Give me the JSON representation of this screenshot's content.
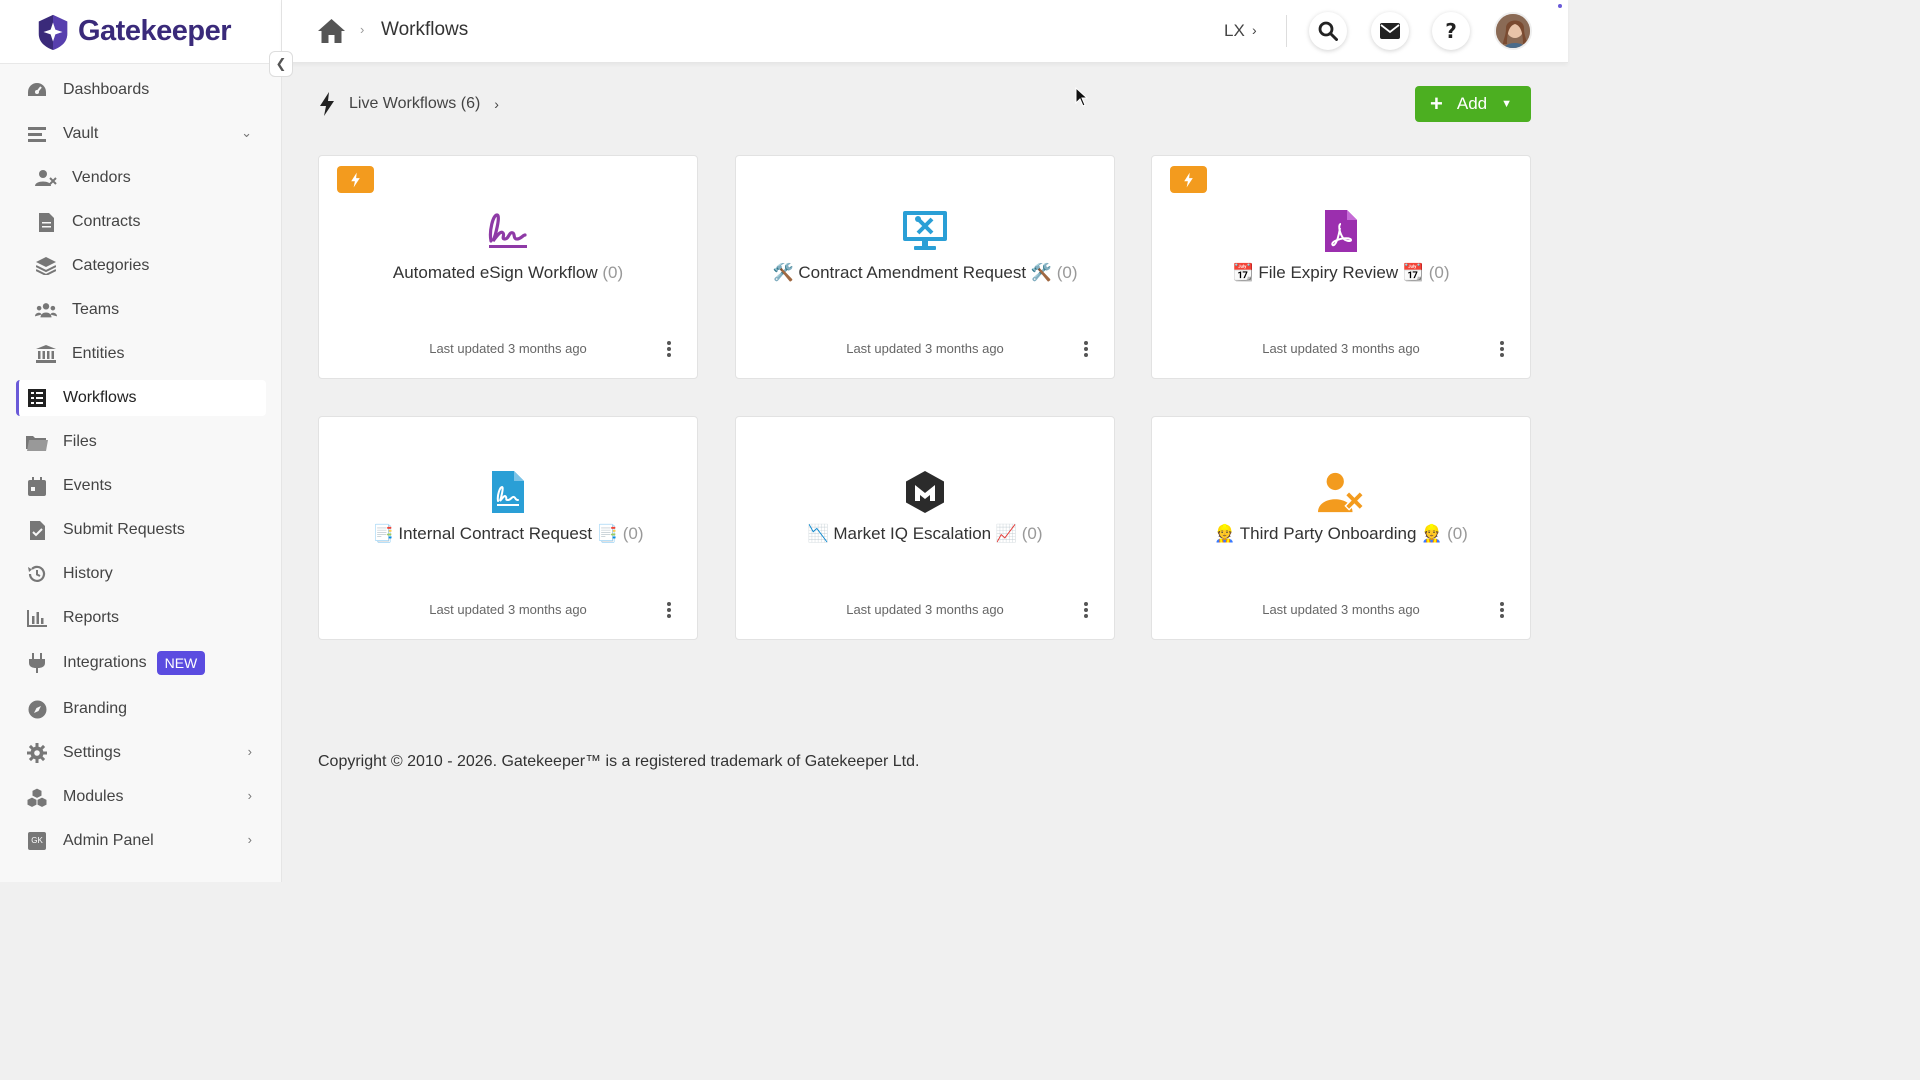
{
  "app": {
    "name": "Gatekeeper",
    "brand_color": "#3a2a7a",
    "accent_color": "#6a5ad8"
  },
  "sidebar": {
    "items": [
      {
        "label": "Dashboards",
        "icon": "dashboard-icon"
      },
      {
        "label": "Vault",
        "icon": "vault-icon",
        "expanded": true
      },
      {
        "label": "Vendors",
        "icon": "vendors-icon"
      },
      {
        "label": "Contracts",
        "icon": "contracts-icon"
      },
      {
        "label": "Categories",
        "icon": "layers-icon"
      },
      {
        "label": "Teams",
        "icon": "teams-icon"
      },
      {
        "label": "Entities",
        "icon": "bank-icon"
      },
      {
        "label": "Workflows",
        "icon": "grid-icon",
        "active": true
      },
      {
        "label": "Files",
        "icon": "folder-icon"
      },
      {
        "label": "Events",
        "icon": "calendar-icon"
      },
      {
        "label": "Submit Requests",
        "icon": "file-check-icon"
      },
      {
        "label": "History",
        "icon": "history-icon"
      },
      {
        "label": "Reports",
        "icon": "bar-chart-icon"
      },
      {
        "label": "Integrations",
        "icon": "plug-icon",
        "badge": "NEW"
      },
      {
        "label": "Branding",
        "icon": "compass-icon"
      },
      {
        "label": "Settings",
        "icon": "gear-icon"
      },
      {
        "label": "Modules",
        "icon": "cubes-icon"
      },
      {
        "label": "Admin Panel",
        "icon": "gk-icon",
        "icon_text": "GK"
      }
    ]
  },
  "header": {
    "breadcrumb_separator": "›",
    "title": "Workflows",
    "org": "LX"
  },
  "main": {
    "live_label": "Live Workflows (6)",
    "add_label": "Add",
    "add_color": "#4caf21",
    "live_tag_color": "#f39b1e",
    "cards": [
      {
        "title": "Automated eSign Workflow",
        "count": "(0)",
        "updated": "Last updated 3 months ago",
        "live": true,
        "icon": "signature-icon",
        "icon_color": "#8e3aa6"
      },
      {
        "title": "🛠️ Contract Amendment Request 🛠️",
        "count": "(0)",
        "updated": "Last updated 3 months ago",
        "live": false,
        "icon": "monitor-tools-icon",
        "icon_color": "#2a9fd6"
      },
      {
        "title": "📆 File Expiry Review 📆",
        "count": "(0)",
        "updated": "Last updated 3 months ago",
        "live": true,
        "icon": "pdf-file-icon",
        "icon_color": "#9b2fae"
      },
      {
        "title": "📑 Internal Contract Request 📑",
        "count": "(0)",
        "updated": "Last updated 3 months ago",
        "live": false,
        "icon": "file-signature-icon",
        "icon_color": "#2a9fd6"
      },
      {
        "title": "📉 Market IQ Escalation 📈",
        "count": "(0)",
        "updated": "Last updated 3 months ago",
        "live": false,
        "icon": "marketiq-logo-icon",
        "icon_color": "#2b2b2b"
      },
      {
        "title": "👷 Third Party Onboarding 👷",
        "count": "(0)",
        "updated": "Last updated 3 months ago",
        "live": false,
        "icon": "user-tools-icon",
        "icon_color": "#f39b1e"
      }
    ]
  },
  "footer": {
    "text": "Copyright © 2010 - 2026. Gatekeeper™ is a registered trademark of Gatekeeper Ltd."
  }
}
